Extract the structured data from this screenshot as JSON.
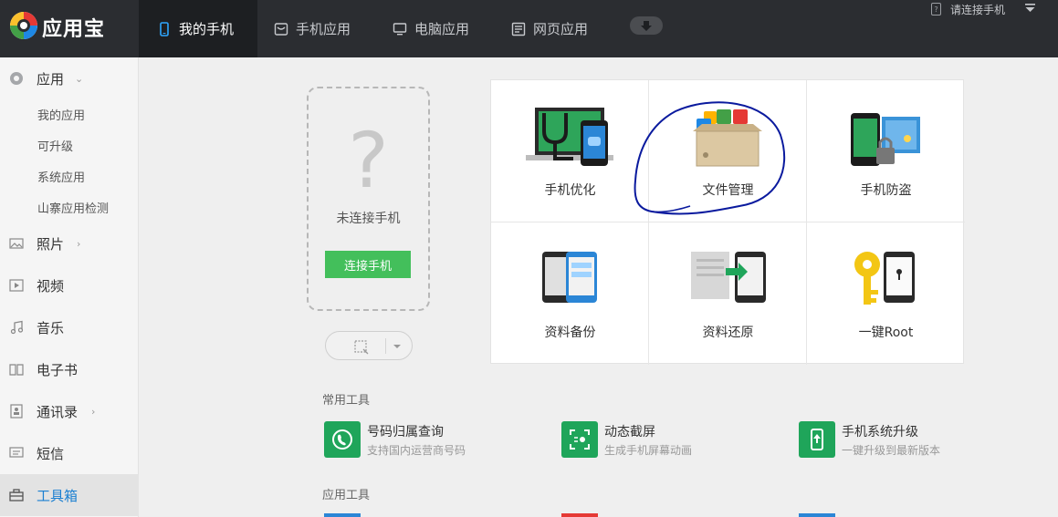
{
  "app": {
    "title": "应用宝"
  },
  "nav": {
    "tabs": [
      {
        "label": "我的手机",
        "icon": "phone-icon",
        "active": true
      },
      {
        "label": "手机应用",
        "icon": "phone-app-icon",
        "active": false
      },
      {
        "label": "电脑应用",
        "icon": "monitor-icon",
        "active": false
      },
      {
        "label": "网页应用",
        "icon": "webpage-icon",
        "active": false
      }
    ],
    "connect_status": "请连接手机"
  },
  "sidebar": {
    "items": [
      {
        "label": "应用",
        "icon": "app-icon"
      },
      {
        "label": "照片",
        "icon": "photo-icon"
      },
      {
        "label": "视频",
        "icon": "video-icon"
      },
      {
        "label": "音乐",
        "icon": "music-icon"
      },
      {
        "label": "电子书",
        "icon": "book-icon"
      },
      {
        "label": "通讯录",
        "icon": "contacts-icon"
      },
      {
        "label": "短信",
        "icon": "sms-icon"
      },
      {
        "label": "工具箱",
        "icon": "toolbox-icon",
        "active": true
      }
    ],
    "app_sub": [
      "我的应用",
      "可升级",
      "系统应用",
      "山寨应用检测"
    ]
  },
  "device": {
    "placeholder": "?",
    "status": "未连接手机",
    "connect_label": "连接手机"
  },
  "tools": [
    {
      "label": "手机优化",
      "icon": "phone-optimize-icon"
    },
    {
      "label": "文件管理",
      "icon": "file-manager-icon"
    },
    {
      "label": "手机防盗",
      "icon": "anti-theft-icon"
    },
    {
      "label": "资料备份",
      "icon": "backup-icon"
    },
    {
      "label": "资料还原",
      "icon": "restore-icon"
    },
    {
      "label": "一键Root",
      "icon": "root-key-icon"
    }
  ],
  "sections": {
    "common": "常用工具",
    "app_tools": "应用工具"
  },
  "common_tools": [
    {
      "title": "号码归属查询",
      "desc": "支持国内运营商号码",
      "icon": "phone-lookup-icon"
    },
    {
      "title": "动态截屏",
      "desc": "生成手机屏幕动画",
      "icon": "screen-capture-icon"
    },
    {
      "title": "手机系统升级",
      "desc": "一键升级到最新版本",
      "icon": "system-upgrade-icon"
    }
  ],
  "colors": {
    "topbar": "#2b2d31",
    "accent_blue": "#1a7fd1",
    "accent_green": "#43bf5b",
    "annotation_circle": "#0a1a9e"
  }
}
